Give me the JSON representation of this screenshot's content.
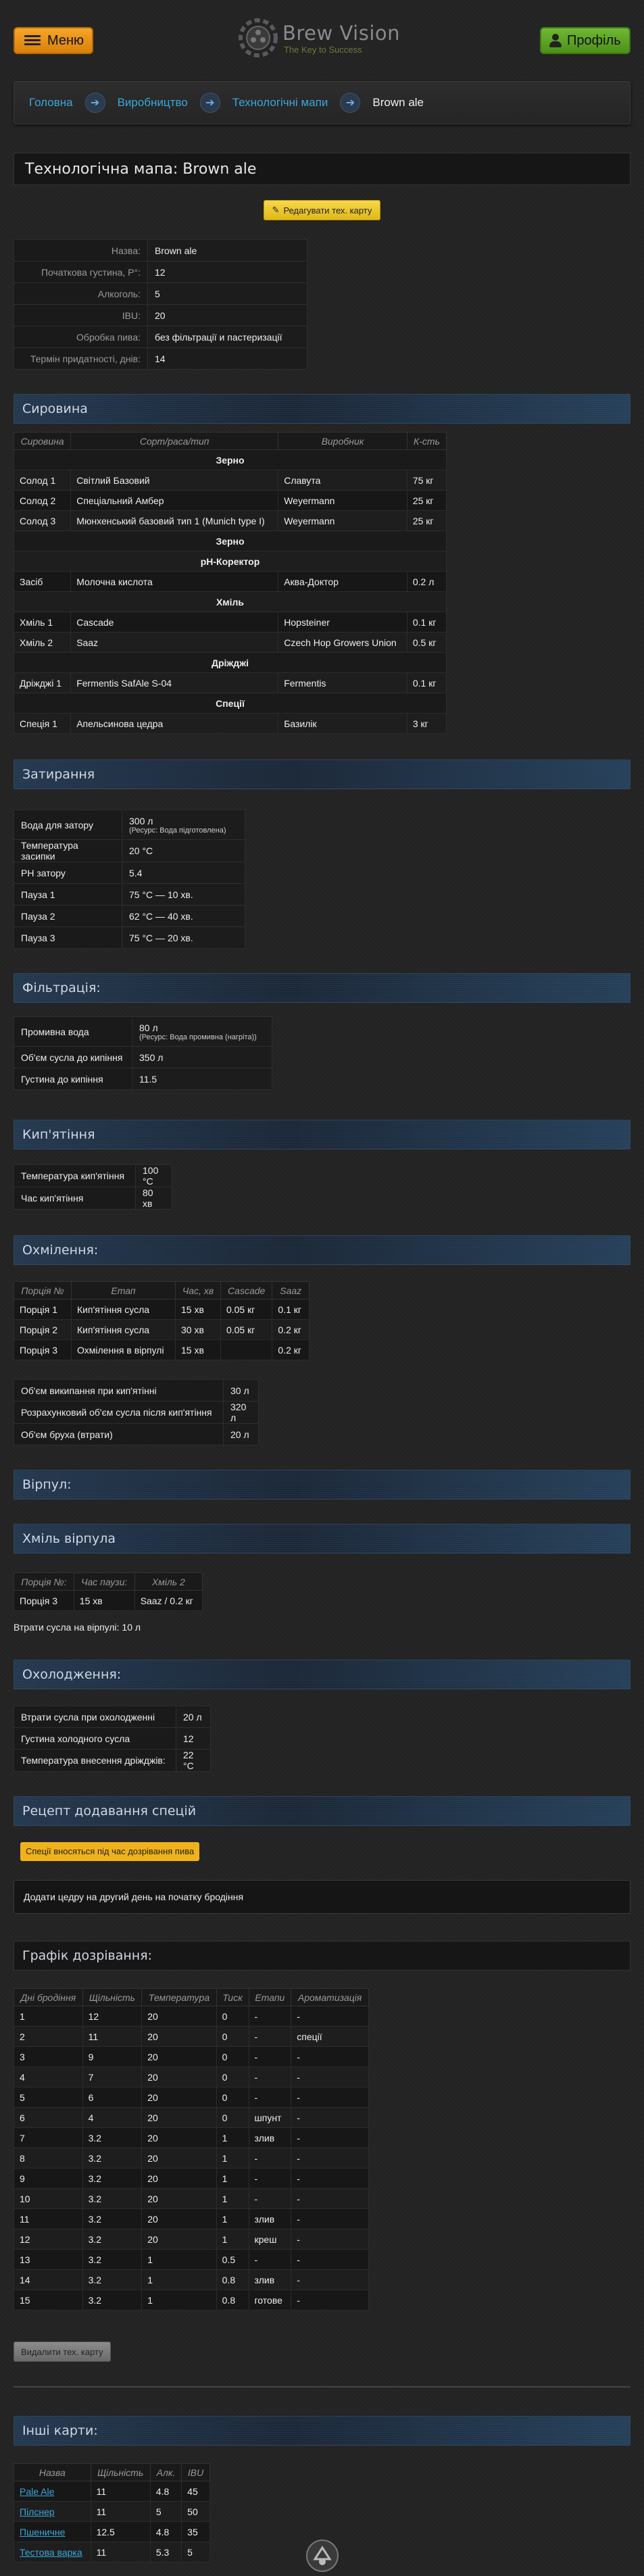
{
  "header": {
    "menu_label": "Меню",
    "logo_title": "Brew Vision",
    "logo_subtitle": "The Key to Success",
    "profile_label": "Профіль"
  },
  "breadcrumb": [
    "Головна",
    "Виробництво",
    "Технологічні мапи",
    "Brown ale"
  ],
  "page_title": "Технологічна мапа: Brown ale",
  "edit_button": "Редагувати тех. карту",
  "summary": [
    {
      "k": "Назва:",
      "v": "Brown ale"
    },
    {
      "k": "Початкова густина, P°:",
      "v": "12"
    },
    {
      "k": "Алкоголь:",
      "v": "5"
    },
    {
      "k": "IBU:",
      "v": "20"
    },
    {
      "k": "Обробка пива:",
      "v": "без фільтрації и пастеризації"
    },
    {
      "k": "Термін придатності, днів:",
      "v": "14"
    }
  ],
  "sections": {
    "raw": "Сировина",
    "mash": "Затирання",
    "filtration": "Фільтрація:",
    "boil": "Кип'ятіння",
    "hopping": "Охмілення:",
    "whirlpool": "Вірпул:",
    "whirlpool_hops": "Хміль вірпула",
    "cooling": "Охолодження:",
    "spice_recipe": "Рецепт додавання спецій",
    "schedule": "Графік дозрівання:",
    "other_maps": "Інші карти:"
  },
  "raw_table": {
    "headers": [
      "Сировина",
      "Сорт/раса/тип",
      "Виробник",
      "К-сть"
    ],
    "groups": [
      {
        "name": "Зерно",
        "rows": [
          [
            "Солод 1",
            "Світлий Базовий",
            "Славута",
            "75 кг"
          ],
          [
            "Солод 2",
            "Спеціальний Амбер",
            "Weyermann",
            "25 кг"
          ],
          [
            "Солод 3",
            "Мюнхенський базовий тип 1 (Munich type I)",
            "Weyermann",
            "25 кг"
          ]
        ]
      },
      {
        "name": "Зерно",
        "rows": []
      },
      {
        "name": "pH-Коректор",
        "rows": [
          [
            "Засіб",
            "Молочна кислота",
            "Аква-Доктор",
            "0.2 л"
          ]
        ]
      },
      {
        "name": "Хміль",
        "rows": [
          [
            "Хміль 1",
            "Cascade",
            "Hopsteiner",
            "0.1 кг"
          ],
          [
            "Хміль 2",
            "Saaz",
            "Czech Hop Growers Union",
            "0.5 кг"
          ]
        ]
      },
      {
        "name": "Дріжджі",
        "rows": [
          [
            "Дріжджі 1",
            "Fermentis SafAle S-04",
            "Fermentis",
            "0.1 кг"
          ]
        ]
      },
      {
        "name": "Спеції",
        "rows": [
          [
            "Спеція 1",
            "Апельсинова цедра",
            "Базилік",
            "3 кг"
          ]
        ]
      }
    ]
  },
  "mash": {
    "water_label": "Вода для затору",
    "water_value": "300 л",
    "water_resource": "(Ресурс: Вода підготовлена)",
    "rows": [
      [
        "Температура засипки",
        "20 °C"
      ],
      [
        "PH затору",
        "5.4"
      ],
      [
        "Пауза 1",
        "75 °C — 10 хв."
      ],
      [
        "Пауза 2",
        "62 °C — 40 хв."
      ],
      [
        "Пауза 3",
        "75 °C — 20 хв."
      ]
    ]
  },
  "filtration": {
    "wash_label": "Промивна вода",
    "wash_value": "80 л",
    "wash_resource": "(Ресурс: Вода промивна (нагріта))",
    "rows": [
      [
        "Об'єм сусла до кипіння",
        "350 л"
      ],
      [
        "Густина до кипіння",
        "11.5"
      ]
    ]
  },
  "boil": {
    "rows": [
      [
        "Температура кип'ятіння",
        "100 °C"
      ],
      [
        "Час кип'ятіння",
        "80 хв"
      ]
    ]
  },
  "hopping": {
    "headers": [
      "Порція №",
      "Етап",
      "Час, хв",
      "Cascade",
      "Saaz"
    ],
    "rows": [
      [
        "Порція 1",
        "Кип'ятіння сусла",
        "15 хв",
        "0.05 кг",
        "0.1 кг"
      ],
      [
        "Порція 2",
        "Кип'ятіння сусла",
        "30 хв",
        "0.05 кг",
        "0.2 кг"
      ],
      [
        "Порція 3",
        "Охмілення в вірпулі",
        "15 хв",
        "",
        "0.2 кг"
      ]
    ],
    "volumes": [
      [
        "Об'єм википання при кип'ятінні",
        "30 л"
      ],
      [
        "Розрахунковий об'єм сусла після кип'ятіння",
        "320 л"
      ],
      [
        "Об'єм бруха (втрати)",
        "20 л"
      ]
    ]
  },
  "whirlpool_hops": {
    "headers": [
      "Порція №:",
      "Час паузи:",
      "Хміль 2"
    ],
    "rows": [
      [
        "Порція 3",
        "15 хв",
        "Saaz / 0.2 кг"
      ]
    ],
    "loss_text": "Втрати сусла на вірпулі: 10 л"
  },
  "cooling": {
    "rows": [
      [
        "Втрати сусла при охолодженні",
        "20 л"
      ],
      [
        "Густина холодного сусла",
        "12"
      ],
      [
        "Температура внесення дріжджів:",
        "22 °C"
      ]
    ]
  },
  "spices": {
    "badge": "Спеції вносяться під час дозрівання пива",
    "note": "Додати цедру на другий день на початку бродіння"
  },
  "schedule": {
    "headers": [
      "Дні бродіння",
      "Щільність",
      "Температура",
      "Тиск",
      "Етапи",
      "Ароматизація"
    ],
    "rows": [
      [
        "1",
        "12",
        "20",
        "0",
        "-",
        "-"
      ],
      [
        "2",
        "11",
        "20",
        "0",
        "-",
        "спеції"
      ],
      [
        "3",
        "9",
        "20",
        "0",
        "-",
        "-"
      ],
      [
        "4",
        "7",
        "20",
        "0",
        "-",
        "-"
      ],
      [
        "5",
        "6",
        "20",
        "0",
        "-",
        "-"
      ],
      [
        "6",
        "4",
        "20",
        "0",
        "шпунт",
        "-"
      ],
      [
        "7",
        "3.2",
        "20",
        "1",
        "злив",
        "-"
      ],
      [
        "8",
        "3.2",
        "20",
        "1",
        "-",
        "-"
      ],
      [
        "9",
        "3.2",
        "20",
        "1",
        "-",
        "-"
      ],
      [
        "10",
        "3.2",
        "20",
        "1",
        "-",
        "-"
      ],
      [
        "11",
        "3.2",
        "20",
        "1",
        "злив",
        "-"
      ],
      [
        "12",
        "3.2",
        "20",
        "1",
        "креш",
        "-"
      ],
      [
        "13",
        "3.2",
        "1",
        "0.5",
        "-",
        "-"
      ],
      [
        "14",
        "3.2",
        "1",
        "0.8",
        "злив",
        "-"
      ],
      [
        "15",
        "3.2",
        "1",
        "0.8",
        "готове",
        "-"
      ]
    ]
  },
  "delete_button": "Видалити тех. карту",
  "other_maps": {
    "headers": [
      "Назва",
      "Щільність",
      "Алк.",
      "IBU"
    ],
    "rows": [
      [
        "Pale Ale",
        "11",
        "4.8",
        "45"
      ],
      [
        "Пілснер",
        "11",
        "5",
        "50"
      ],
      [
        "Пшеничне",
        "12.5",
        "4.8",
        "35"
      ],
      [
        "Тестова варка",
        "11",
        "5.3",
        "5"
      ]
    ]
  }
}
